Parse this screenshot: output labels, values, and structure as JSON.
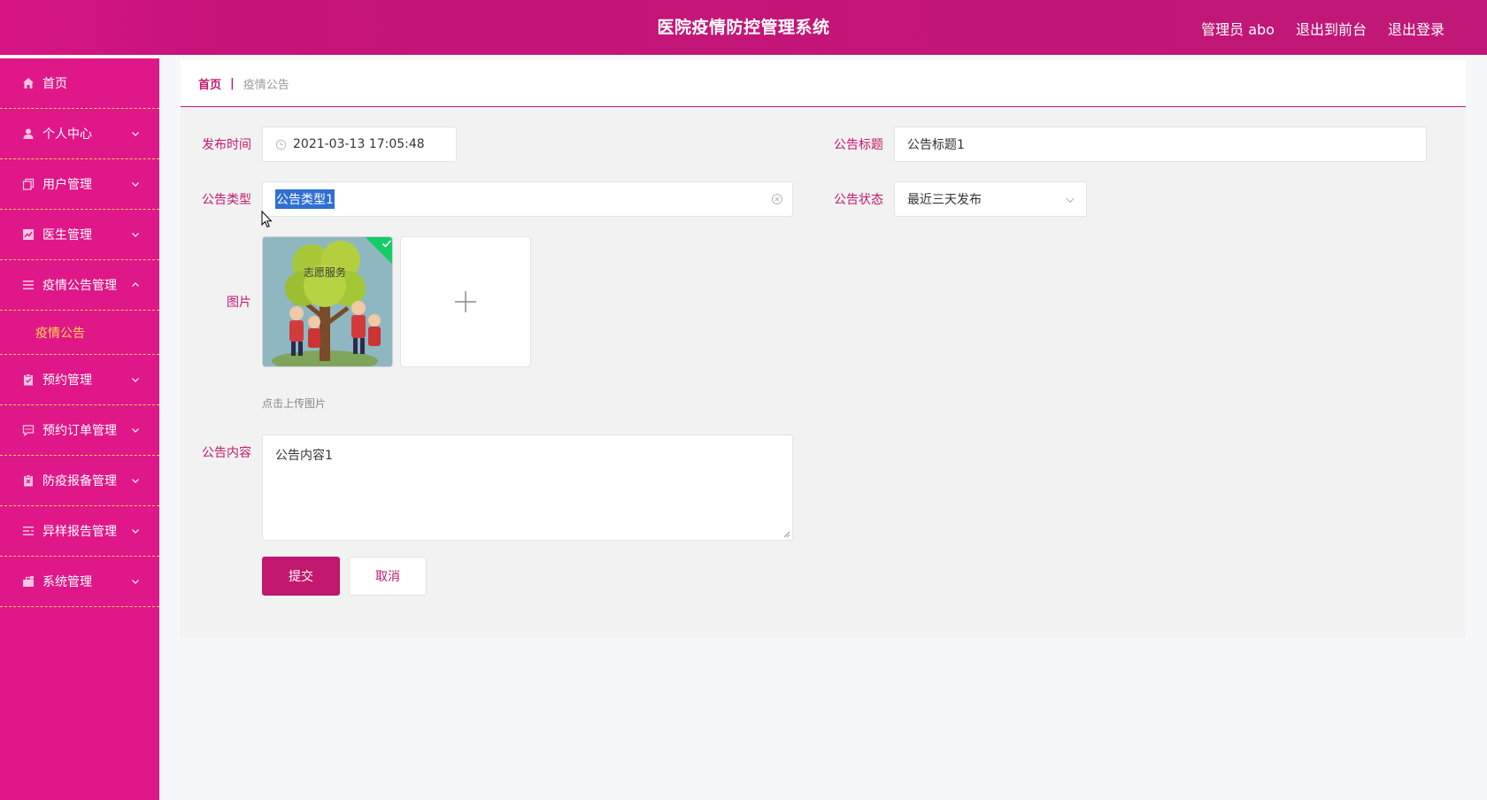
{
  "header": {
    "title": "医院疫情防控管理系统",
    "user": "管理员 abo",
    "to_frontend": "退出到前台",
    "logout": "退出登录"
  },
  "sidebar": {
    "items": [
      {
        "label": "首页",
        "icon": "home-icon"
      },
      {
        "label": "个人中心",
        "icon": "user-icon"
      },
      {
        "label": "用户管理",
        "icon": "copy-icon"
      },
      {
        "label": "医生管理",
        "icon": "chart-icon"
      },
      {
        "label": "疫情公告管理",
        "icon": "list-icon",
        "expanded": true
      },
      {
        "label": "预约管理",
        "icon": "clipboard-icon"
      },
      {
        "label": "预约订单管理",
        "icon": "chat-icon"
      },
      {
        "label": "防疫报备管理",
        "icon": "clipboard-x-icon"
      },
      {
        "label": "异样报告管理",
        "icon": "list-alt-icon"
      },
      {
        "label": "系统管理",
        "icon": "briefcase-icon"
      }
    ],
    "active_sub": "疫情公告"
  },
  "breadcrumb": {
    "home": "首页",
    "separator": "|",
    "current": "疫情公告"
  },
  "form": {
    "publish_time_label": "发布时间",
    "publish_time_value": "2021-03-13 17:05:48",
    "title_label": "公告标题",
    "title_value": "公告标题1",
    "type_label": "公告类型",
    "type_value": "公告类型1",
    "status_label": "公告状态",
    "status_value": "最近三天发布",
    "image_label": "图片",
    "upload_hint": "点击上传图片",
    "thumb_text": "志愿服务",
    "content_label": "公告内容",
    "content_value": "公告内容1",
    "submit_label": "提交",
    "cancel_label": "取消"
  },
  "colors": {
    "header": "#c6137a",
    "sidebar": "#e01788",
    "accent": "#c2186f",
    "submenu_active": "#ffd84a",
    "success": "#13ce66"
  }
}
